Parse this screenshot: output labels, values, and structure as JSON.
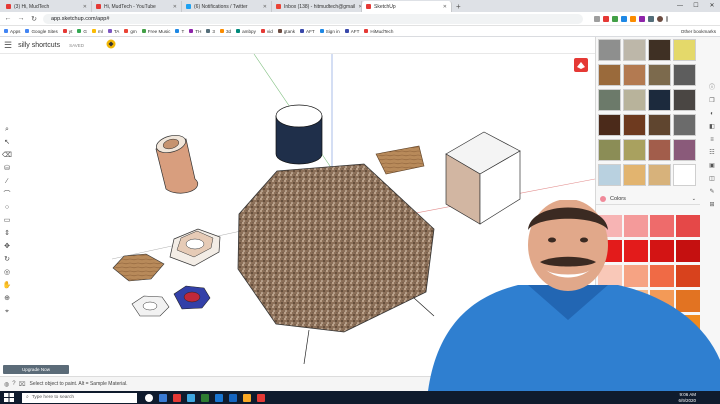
{
  "browser": {
    "tabs": [
      {
        "label": "(3) Hi, MudTech",
        "color": "#e53935",
        "active": false
      },
      {
        "label": "Hi, MudTech - YouTube",
        "color": "#e53935",
        "active": false
      },
      {
        "label": "(6) Notifications / Twitter",
        "color": "#1da1f2",
        "active": false
      },
      {
        "label": "Inbox (138) - hitmudtech@gmail",
        "color": "#ea4335",
        "active": false
      },
      {
        "label": "SketchUp",
        "color": "#e53935",
        "active": true
      }
    ],
    "new_tab": "+",
    "url": "app.sketchup.com/app#",
    "window_controls": [
      "—",
      "☐",
      "✕"
    ]
  },
  "bookmarks": {
    "items": [
      {
        "label": "Apps",
        "color": "#4285f4"
      },
      {
        "label": "Google Sites",
        "color": "#4285f4"
      },
      {
        "label": "yt",
        "color": "#e53935"
      },
      {
        "label": "G",
        "color": "#34a853"
      },
      {
        "label": "ml",
        "color": "#fbbc05"
      },
      {
        "label": "TA",
        "color": "#7e57c2"
      },
      {
        "label": "gm",
        "color": "#ea4335"
      },
      {
        "label": "Free Music",
        "color": "#43a047"
      },
      {
        "label": "T",
        "color": "#1e88e5"
      },
      {
        "label": "TH",
        "color": "#8e24aa"
      },
      {
        "label": "3",
        "color": "#546e7a"
      },
      {
        "label": "3d",
        "color": "#fb8c00"
      },
      {
        "label": "ambpy",
        "color": "#00897b"
      },
      {
        "label": "vid",
        "color": "#e53935"
      },
      {
        "label": "gtank",
        "color": "#6d4c41"
      },
      {
        "label": "AFT",
        "color": "#3949ab"
      },
      {
        "label": "Sign in",
        "color": "#1e88e5"
      },
      {
        "label": "AFT",
        "color": "#3949ab"
      },
      {
        "label": "HiMudTech",
        "color": "#e53935"
      }
    ],
    "other": "Other bookmarks"
  },
  "app": {
    "title": "silly shortcuts",
    "saved": "SAVED",
    "upgrade_label": "Upgrade Now",
    "status_text": "Select object to paint. Alt = Sample Material.",
    "toolbar_icons": [
      "search-icon",
      "select-arrow-icon",
      "eraser-icon",
      "paint-bucket-icon",
      "line-icon",
      "arc-icon",
      "circle-icon",
      "shape-icon",
      "push-pull-icon",
      "move-icon",
      "rotate-icon",
      "orbit-icon",
      "pan-icon",
      "zoom-icon",
      "tape-icon"
    ],
    "side_icons": [
      "info-icon",
      "components-icon",
      "materials-icon",
      "styles-icon",
      "layers-icon",
      "outliner-icon",
      "scenes-icon",
      "display-icon",
      "instructor-icon",
      "extensions-icon"
    ]
  },
  "materials": {
    "selector_label": "Colors",
    "textures": [
      "#8e8f8e",
      "#bdb7a9",
      "#3f3024",
      "#e4d96a",
      "#9a6a3b",
      "#b37a51",
      "#7c6a4d",
      "#5d5d5d",
      "#6c7a6a",
      "#b8b39b",
      "#1c2a3d",
      "#4a4643",
      "#4b2a1a",
      "#6e3a1f",
      "#5f452f",
      "#6b6b6b",
      "#8b8d56",
      "#a9a15f",
      "#a25d4b",
      "#8a5a7a",
      "#b9d1e0",
      "#e2b46f",
      "#d7b27b",
      "#ffffff"
    ],
    "colors": [
      "#f7b4b4",
      "#f49a9a",
      "#ee6b6b",
      "#e54848",
      "#e31b1b",
      "#e31b1b",
      "#d31414",
      "#c51010",
      "#f9c8b8",
      "#f6a383",
      "#f06a45",
      "#d8421d",
      "#f4cfae",
      "#f5b98a",
      "#f39a57",
      "#e27322",
      "#f7d9b8",
      "#f8c18d",
      "#f6a351",
      "#f08a1e",
      "#fbe5c4",
      "#fad3a0",
      "#f8be73",
      "#e89a2e"
    ]
  },
  "taskbar": {
    "search_placeholder": "Type here to search",
    "time": "9:06 AM",
    "date": "6/9/2020",
    "app_colors": [
      "#ffffff",
      "#3a7bd5",
      "#e53935",
      "#3fa7e0",
      "#2e7d32",
      "#1976d2",
      "#1565c0",
      "#f9a825",
      "#e53935"
    ]
  }
}
